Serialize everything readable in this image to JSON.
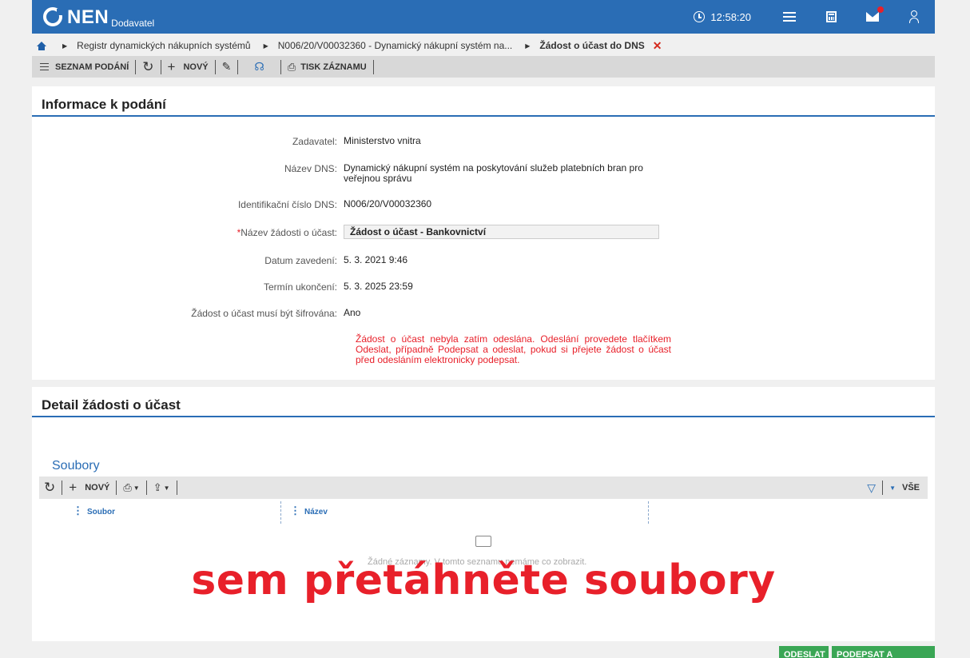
{
  "header": {
    "logo": "NEN",
    "logo_sub": "Dodavatel",
    "time": "12:58:20",
    "icons": [
      "clock-icon",
      "menu-icon",
      "calculator-icon",
      "mail-icon",
      "user-icon"
    ],
    "brand_color": "#2a6db5"
  },
  "breadcrumb": {
    "items": [
      "Registr dynamických nákupních systémů",
      "N006/20/V00032360 - Dynamický nákupní systém na..."
    ],
    "current": "Žádost o účast do DNS",
    "close_symbol": "✕"
  },
  "toolbar": {
    "list_label": "SEZNAM PODÁNÍ",
    "new_label": "NOVÝ",
    "print_label": "TISK ZÁZNAMU"
  },
  "info": {
    "title": "Informace k podání",
    "fields": [
      {
        "label": "Zadavatel:",
        "value": "Ministerstvo vnitra"
      },
      {
        "label": "Název DNS:",
        "value": "Dynamický nákupní systém na poskytování služeb platebních bran pro veřejnou správu"
      },
      {
        "label": "Identifikační číslo DNS:",
        "value": "N006/20/V00032360"
      },
      {
        "label": "Název žádosti o účast:",
        "value": "Žádost o účast - Bankovnictví",
        "required": true
      },
      {
        "label": "Datum zavedení:",
        "value": "5. 3. 2021 9:46"
      },
      {
        "label": "Termín ukončení:",
        "value": "5. 3. 2025 23:59"
      },
      {
        "label": "Žádost o účast musí být šifrována:",
        "value": "Ano"
      }
    ],
    "required_mark": "*",
    "warning": "Žádost o účast nebyla zatím odeslána. Odeslání provedete tlačítkem Odeslat, případně Podepsat a odeslat, pokud si přejete žádost o účast před odesláním elektronicky podepsat.",
    "warning_color": "#e8202a"
  },
  "detail": {
    "title": "Detail žádosti o účast",
    "files_title": "Soubory",
    "files_toolbar": {
      "new_label": "NOVÝ",
      "all_label": "VŠE"
    },
    "columns": [
      "Soubor",
      "Název"
    ],
    "empty_text": "Žádné záznamy. V tomto seznamu nemáme co zobrazit.",
    "drop_text": "sem přetáhněte soubory"
  },
  "actions": {
    "send_label": "ODESLAT",
    "sign_send_label": "PODEPSAT A ODESLAT",
    "button_color": "#3aa655"
  }
}
